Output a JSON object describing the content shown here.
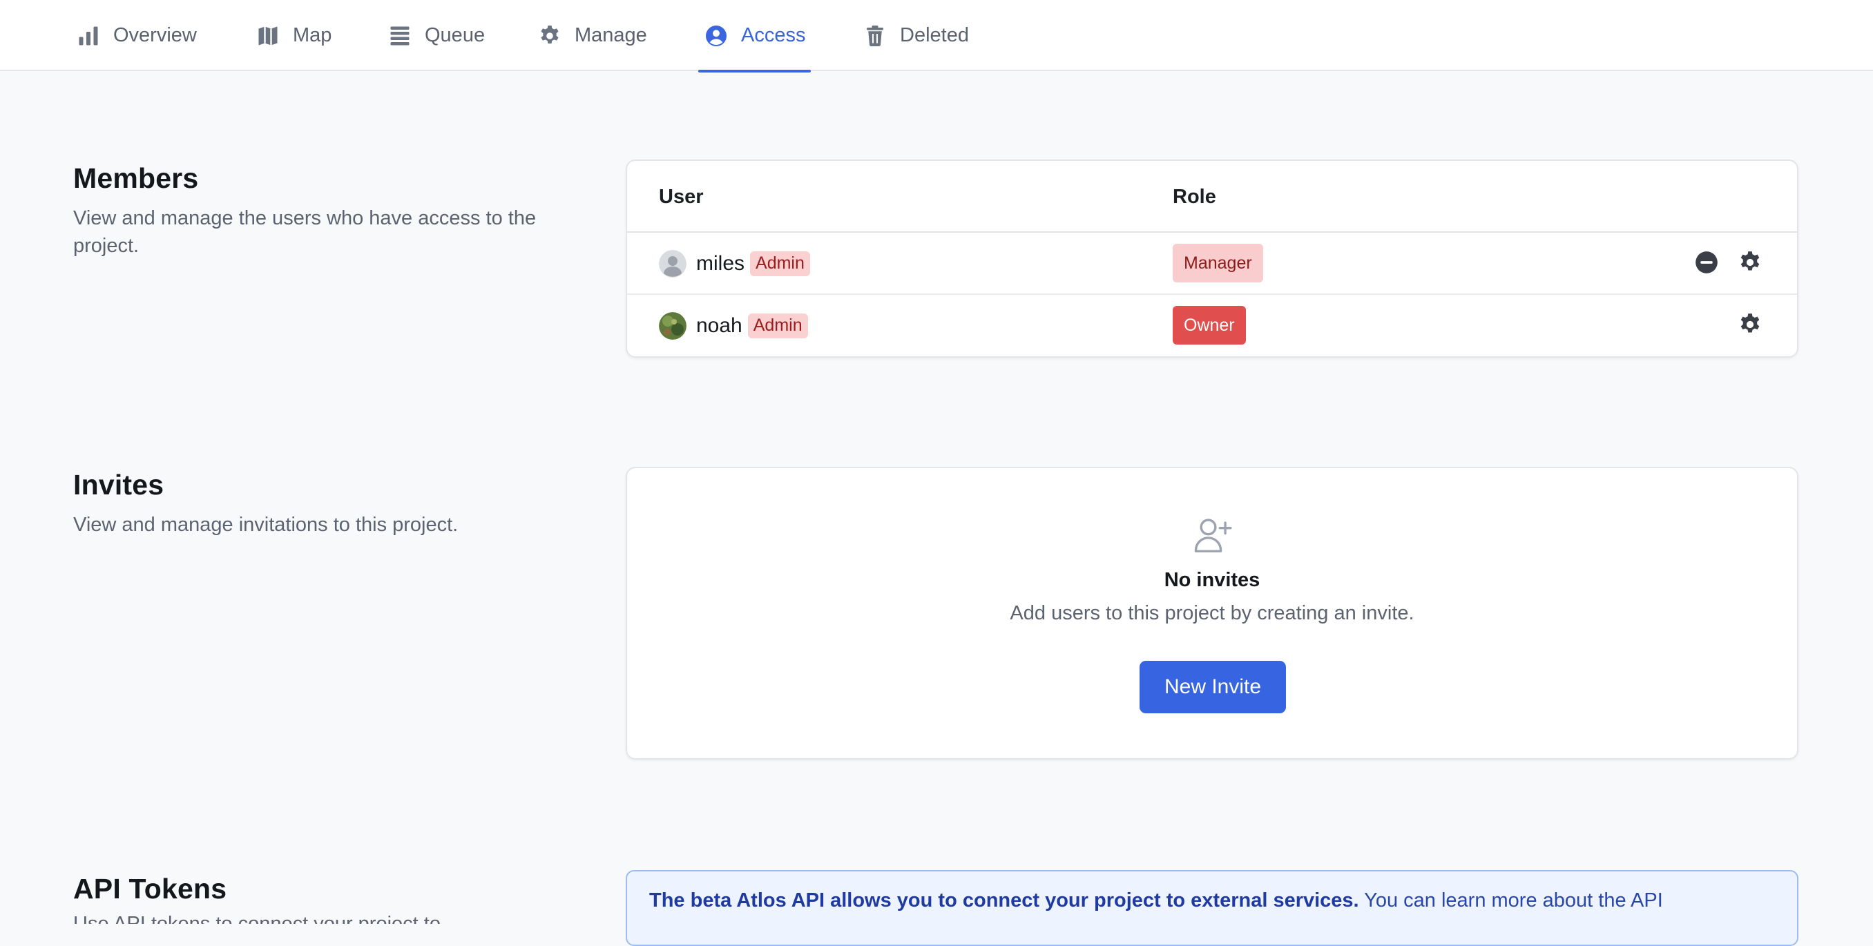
{
  "tabs": [
    {
      "label": "Overview",
      "icon": "bar-chart-icon",
      "active": false
    },
    {
      "label": "Map",
      "icon": "map-icon",
      "active": false
    },
    {
      "label": "Queue",
      "icon": "queue-stack-icon",
      "active": false
    },
    {
      "label": "Manage",
      "icon": "gear-icon",
      "active": false
    },
    {
      "label": "Access",
      "icon": "user-circle-icon",
      "active": true
    },
    {
      "label": "Deleted",
      "icon": "trash-icon",
      "active": false
    }
  ],
  "members": {
    "title": "Members",
    "description": "View and manage the users who have access to the project.",
    "columns": {
      "user": "User",
      "role": "Role"
    },
    "rows": [
      {
        "username": "miles",
        "badge": "Admin",
        "role": "Manager",
        "avatar": "default-avatar-icon"
      },
      {
        "username": "noah",
        "badge": "Admin",
        "role": "Owner",
        "avatar": "photo-avatar"
      }
    ]
  },
  "invites": {
    "title": "Invites",
    "description": "View and manage invitations to this project.",
    "empty_title": "No invites",
    "empty_description": "Add users to this project by creating an invite.",
    "button_label": "New Invite",
    "icon": "user-plus-icon"
  },
  "api_tokens": {
    "title": "API Tokens",
    "description": "Use API tokens to connect your project to",
    "banner_bold": "The beta Atlos API allows you to connect your project to external services.",
    "banner_text": " You can learn more about the API"
  },
  "colors": {
    "accent": "#3b66e0",
    "admin_badge_bg": "#fbd0d0",
    "owner_badge_bg": "#e04e4e",
    "manager_badge_bg": "#f9cdcd"
  }
}
